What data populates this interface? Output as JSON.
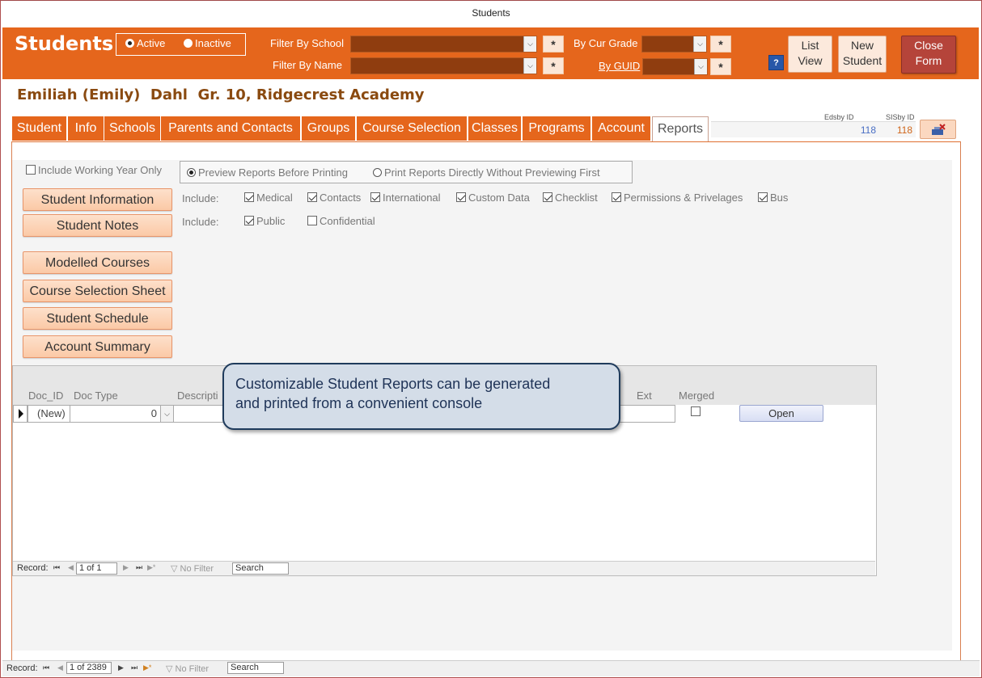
{
  "window": {
    "title": "Students"
  },
  "header": {
    "title": "Students",
    "status": {
      "active_label": "Active",
      "inactive_label": "Inactive",
      "selected": "Active"
    },
    "filter_school_label": "Filter By School",
    "filter_name_label": "Filter By Name",
    "cur_grade_label": "By Cur Grade",
    "guid_label": "By GUID",
    "star": "*",
    "help": "?",
    "list_view_label": "List View",
    "list_view_l1": "List",
    "list_view_l2": "View",
    "new_student_l1": "New",
    "new_student_l2": "Student",
    "close_form_l1": "Close",
    "close_form_l2": "Form"
  },
  "student": {
    "name": "Emiliah (Emily)  Dahl  Gr. 10, Ridgecrest Academy"
  },
  "tabs": [
    {
      "label": "Student"
    },
    {
      "label": "Info"
    },
    {
      "label": "Schools"
    },
    {
      "label": "Parents and Contacts"
    },
    {
      "label": "Groups"
    },
    {
      "label": "Course Selection"
    },
    {
      "label": "Classes"
    },
    {
      "label": "Programs"
    },
    {
      "label": "Account"
    },
    {
      "label": "Reports"
    }
  ],
  "ids": {
    "edsby_label": "Edsby ID",
    "edsby_value": "118",
    "sisby_label": "SISby ID",
    "sisby_value": "118"
  },
  "colors": {
    "accent": "#e5661c",
    "close": "#b5443a",
    "edsby_value": "#4a6fc4",
    "sisby_value": "#d0661a"
  },
  "reports": {
    "working_year_label": "Include Working Year Only",
    "preview_label": "Preview Reports Before Printing",
    "direct_label": "Print Reports Directly Without Previewing First",
    "include_label": "Include:",
    "include_row1": [
      "Medical",
      "Contacts",
      "International",
      "Custom Data",
      "Checklist",
      "Permissions & Privelages",
      "Bus"
    ],
    "include_row2": [
      {
        "label": "Public",
        "checked": true
      },
      {
        "label": "Confidential",
        "checked": false
      }
    ],
    "buttons": {
      "student_information": "Student Information",
      "student_notes": "Student Notes",
      "modelled_courses": "Modelled Courses",
      "course_selection_sheet": "Course Selection Sheet",
      "student_schedule": "Student Schedule",
      "account_summary": "Account Summary"
    }
  },
  "documents": {
    "columns": {
      "doc_id": "Doc_ID",
      "doc_type": "Doc Type",
      "description": "Descripti",
      "ext": "Ext",
      "merged": "Merged"
    },
    "new_row": {
      "doc_id": "(New)",
      "doc_type": "0"
    },
    "open_label": "Open",
    "nav": {
      "record_label": "Record:",
      "position": "1 of 1",
      "filter": "No Filter",
      "search": "Search"
    }
  },
  "form_nav": {
    "record_label": "Record:",
    "position": "1 of 2389",
    "filter": "No Filter",
    "search": "Search"
  },
  "callout": {
    "line1": "Customizable Student Reports can be generated",
    "line2": "and printed from a convenient console"
  }
}
